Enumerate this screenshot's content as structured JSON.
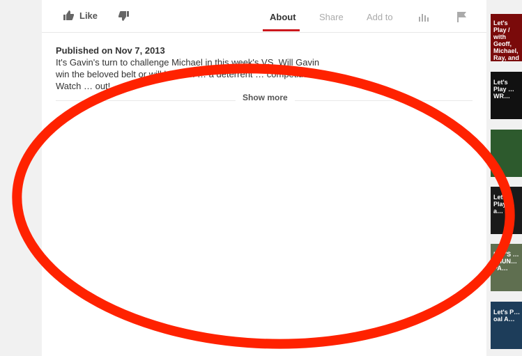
{
  "actions": {
    "like_label": "Like",
    "icons": {
      "like": "thumbs-up-icon",
      "dislike": "thumbs-down-icon",
      "stats": "bar-chart-icon",
      "flag": "flag-icon"
    }
  },
  "tabs": [
    {
      "label": "About",
      "active": true
    },
    {
      "label": "Share",
      "active": false
    },
    {
      "label": "Add to",
      "active": false
    }
  ],
  "description": {
    "published": "Published on Nov 7, 2013",
    "text": "It's Gavin's turn to challenge Michael in this week's VS. Will Gavin win the beloved belt or will his cool … a deterrent … competition? Watch … out!"
  },
  "show_more_label": "Show more",
  "colors": {
    "accent": "#cc181e",
    "annotation_ellipse": "#ff2200",
    "panel": "#ffffff",
    "page": "#f1f1f1"
  },
  "sidebar_thumbnails": [
    {
      "text": "Let's Play / with Geoff, Michael, Ray, and …",
      "color": "#8b0000"
    },
    {
      "text": "Let's Play … WR…",
      "color": "#1a1a1a"
    },
    {
      "text": "",
      "color": "#2d5a2d"
    },
    {
      "text": "Let's Play … a…",
      "color": "#222222"
    },
    {
      "text": "LET'S … THUN… PA…",
      "color": "#6b7b5b"
    },
    {
      "text": "Let's P… oal A…",
      "color": "#1d3d5a"
    }
  ]
}
